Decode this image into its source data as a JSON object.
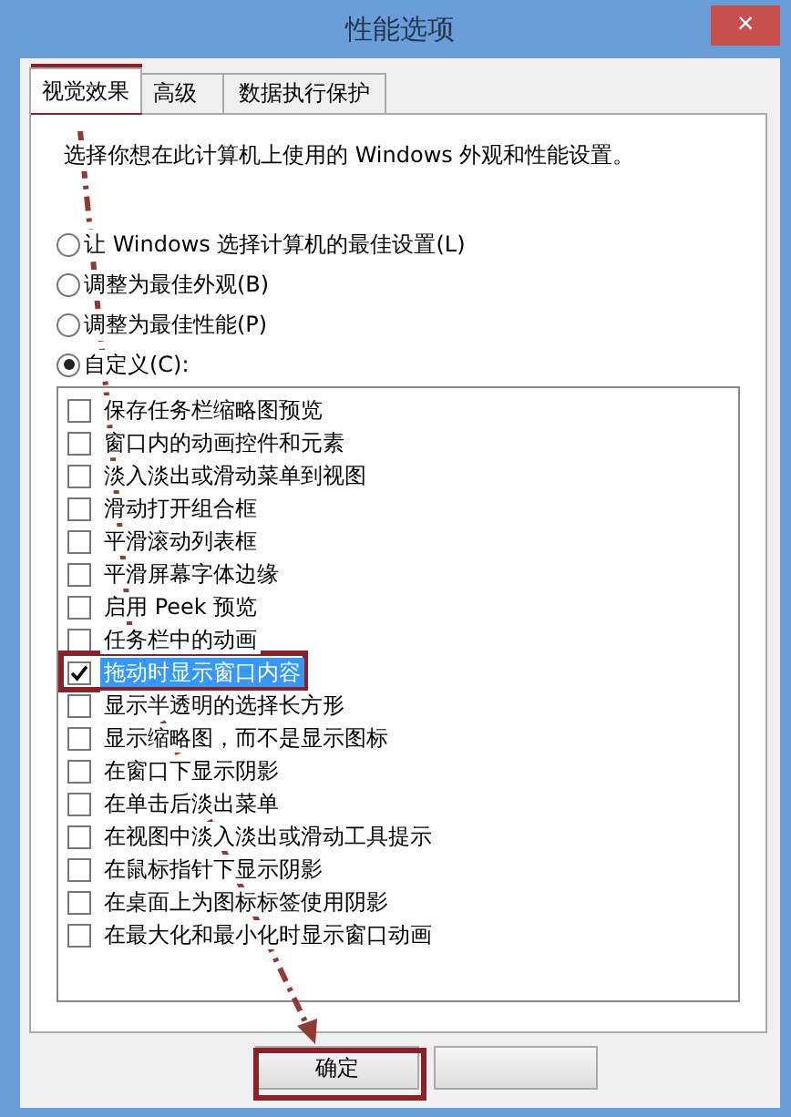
{
  "window": {
    "title": "性能选项",
    "close": "×"
  },
  "tabs": [
    {
      "label": "视觉效果",
      "selected": true
    },
    {
      "label": "高级",
      "selected": false
    },
    {
      "label": "数据执行保护",
      "selected": false
    }
  ],
  "intro": "选择你想在此计算机上使用的 Windows 外观和性能设置。",
  "options": [
    {
      "label": "让 Windows 选择计算机的最佳设置(L)",
      "selected": false
    },
    {
      "label": "调整为最佳外观(B)",
      "selected": false
    },
    {
      "label": "调整为最佳性能(P)",
      "selected": false
    },
    {
      "label": "自定义(C):",
      "selected": true
    }
  ],
  "effects": [
    {
      "label": "保存任务栏缩略图预览",
      "checked": false,
      "selected": false
    },
    {
      "label": "窗口内的动画控件和元素",
      "checked": false,
      "selected": false
    },
    {
      "label": "淡入淡出或滑动菜单到视图",
      "checked": false,
      "selected": false
    },
    {
      "label": "滑动打开组合框",
      "checked": false,
      "selected": false
    },
    {
      "label": "平滑滚动列表框",
      "checked": false,
      "selected": false
    },
    {
      "label": "平滑屏幕字体边缘",
      "checked": false,
      "selected": false
    },
    {
      "label": "启用 Peek 预览",
      "checked": false,
      "selected": false
    },
    {
      "label": "任务栏中的动画",
      "checked": false,
      "selected": false
    },
    {
      "label": "拖动时显示窗口内容",
      "checked": true,
      "selected": true
    },
    {
      "label": "显示半透明的选择长方形",
      "checked": false,
      "selected": false
    },
    {
      "label": "显示缩略图，而不是显示图标",
      "checked": false,
      "selected": false
    },
    {
      "label": "在窗口下显示阴影",
      "checked": false,
      "selected": false
    },
    {
      "label": "在单击后淡出菜单",
      "checked": false,
      "selected": false
    },
    {
      "label": "在视图中淡入淡出或滑动工具提示",
      "checked": false,
      "selected": false
    },
    {
      "label": "在鼠标指针下显示阴影",
      "checked": false,
      "selected": false
    },
    {
      "label": "在桌面上为图标标签使用阴影",
      "checked": false,
      "selected": false
    },
    {
      "label": "在最大化和最小化时显示窗口动画",
      "checked": false,
      "selected": false
    }
  ],
  "buttons": [
    {
      "label": "确定"
    }
  ]
}
